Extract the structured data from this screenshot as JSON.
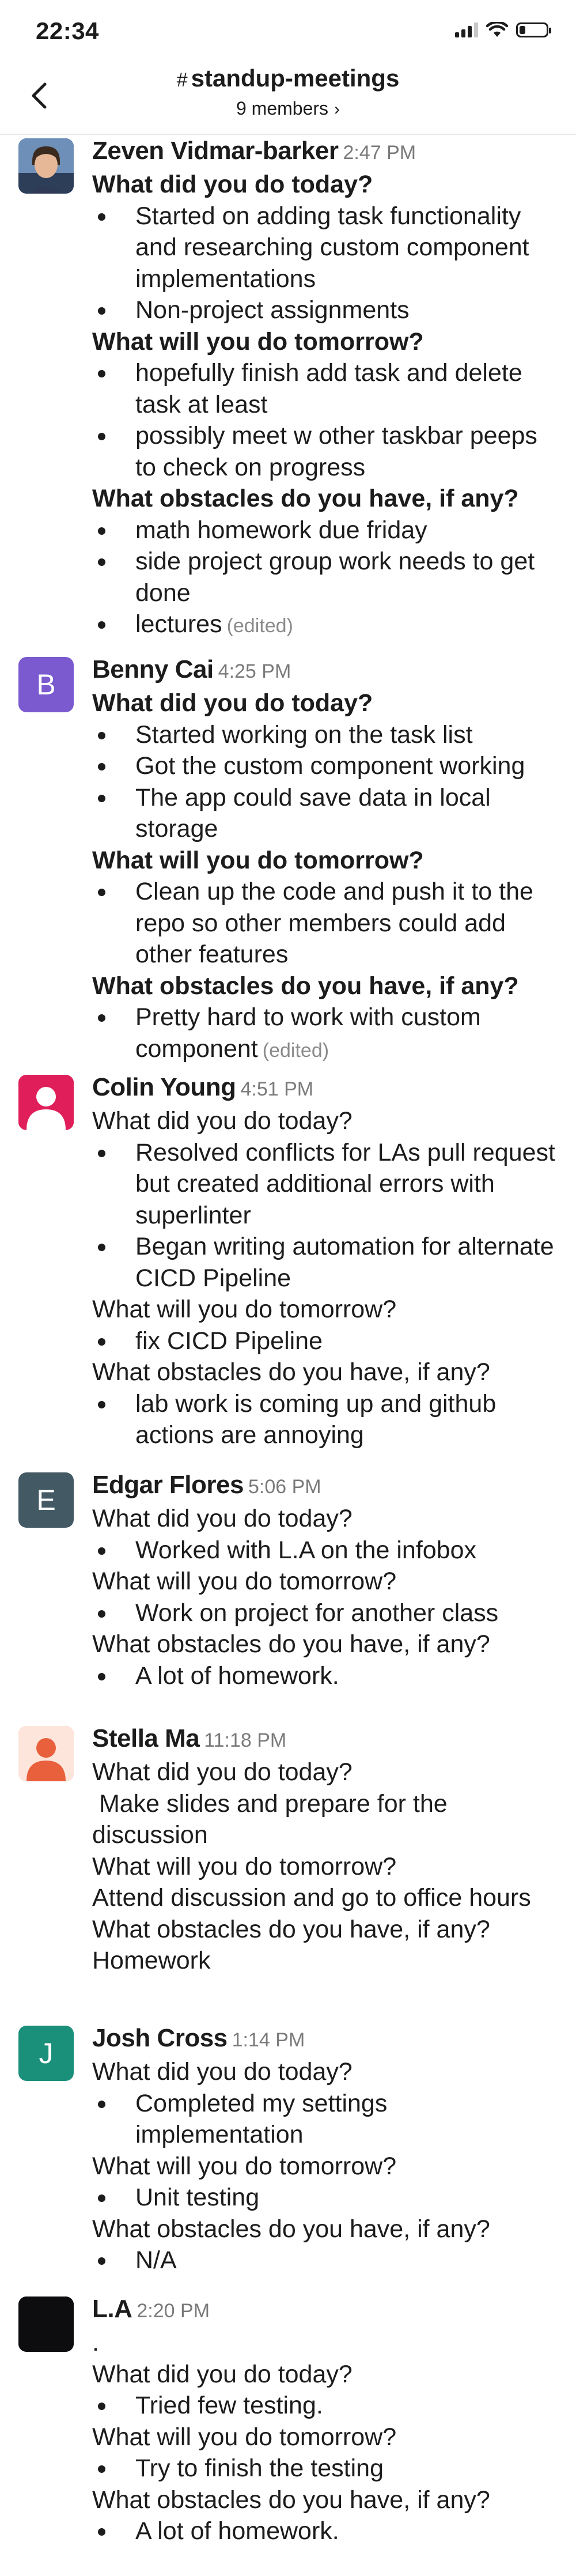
{
  "status_bar": {
    "time": "22:34"
  },
  "header": {
    "hash": "#",
    "channel_name": "standup-meetings",
    "member_count": "9 members",
    "member_chevron": "›",
    "back_icon": "chevron-left-icon"
  },
  "messages": [
    {
      "author": "Zeven Vidmar-barker",
      "time": "2:47 PM",
      "avatar": {
        "type": "photo",
        "color": "#3a5a8c"
      },
      "blocks": [
        {
          "kind": "heading",
          "text": "What did you do today?"
        },
        {
          "kind": "bullet",
          "text": "Started on adding task functionality and researching custom component implementations"
        },
        {
          "kind": "bullet",
          "text": "Non-project assignments"
        },
        {
          "kind": "heading",
          "text": "What will you do tomorrow?"
        },
        {
          "kind": "bullet",
          "text": "hopefully finish add task and delete task at least"
        },
        {
          "kind": "bullet",
          "text": "possibly meet w other taskbar peeps to check on progress"
        },
        {
          "kind": "heading",
          "text": "What obstacles do you have, if any?"
        },
        {
          "kind": "bullet",
          "text": "math homework due friday"
        },
        {
          "kind": "bullet",
          "text": "side project group work needs to get done"
        },
        {
          "kind": "bullet",
          "text": "lectures",
          "edited": "(edited)"
        }
      ]
    },
    {
      "author": "Benny Cai",
      "time": "4:25 PM",
      "avatar": {
        "type": "letter",
        "letter": "B",
        "color": "#7b5ad0"
      },
      "blocks": [
        {
          "kind": "heading",
          "text": "What did you do today?"
        },
        {
          "kind": "bullet",
          "text": "Started working on the task list"
        },
        {
          "kind": "bullet",
          "text": "Got the custom component working"
        },
        {
          "kind": "bullet",
          "text": "The app could save data in local storage"
        },
        {
          "kind": "heading",
          "text": "What will you do tomorrow?"
        },
        {
          "kind": "bullet",
          "text": "Clean up the code and push it to the repo so other members could add other features"
        },
        {
          "kind": "heading",
          "text": "What obstacles do you have, if any?"
        },
        {
          "kind": "bullet",
          "text": "Pretty hard to work with custom component",
          "edited": "(edited)"
        }
      ]
    },
    {
      "author": "Colin Young",
      "time": "4:51 PM",
      "avatar": {
        "type": "default",
        "color": "#e01e5a"
      },
      "blocks": [
        {
          "kind": "text",
          "text": "What did you do today?"
        },
        {
          "kind": "bullet",
          "text": "Resolved conflicts for LAs pull request but created additional errors with superlinter"
        },
        {
          "kind": "bullet",
          "text": "Began writing automation for alternate CICD Pipeline"
        },
        {
          "kind": "text",
          "text": "What will you do tomorrow?"
        },
        {
          "kind": "bullet",
          "text": "fix CICD Pipeline"
        },
        {
          "kind": "text",
          "text": "What obstacles do you have, if any?"
        },
        {
          "kind": "bullet",
          "text": "lab work is coming up and github actions are annoying"
        }
      ]
    },
    {
      "author": "Edgar Flores",
      "time": "5:06 PM",
      "avatar": {
        "type": "letter",
        "letter": "E",
        "color": "#435a64"
      },
      "blocks": [
        {
          "kind": "text",
          "text": "What did you do today?"
        },
        {
          "kind": "bullet",
          "text": "Worked with L.A on the infobox"
        },
        {
          "kind": "text",
          "text": "What will you do tomorrow?"
        },
        {
          "kind": "bullet",
          "text": "Work on project for another class"
        },
        {
          "kind": "text",
          "text": "What obstacles do you have, if any?"
        },
        {
          "kind": "bullet",
          "text": "A lot of homework."
        }
      ]
    },
    {
      "author": "Stella Ma",
      "time": "11:18 PM",
      "avatar": {
        "type": "default",
        "color": "#e8603c"
      },
      "blocks": [
        {
          "kind": "text",
          "text": "What did you do today?"
        },
        {
          "kind": "text",
          "text": " Make slides and prepare for the discussion"
        },
        {
          "kind": "text",
          "text": "What will you do tomorrow?"
        },
        {
          "kind": "text",
          "text": "Attend discussion and go to office hours"
        },
        {
          "kind": "text",
          "text": "What obstacles do you have, if any?"
        },
        {
          "kind": "text",
          "text": "Homework"
        }
      ]
    },
    {
      "author": "Josh Cross",
      "time": "1:14 PM",
      "avatar": {
        "type": "letter",
        "letter": "J",
        "color": "#1a8f7a"
      },
      "blocks": [
        {
          "kind": "text",
          "text": "What did you do today?"
        },
        {
          "kind": "bullet",
          "text": "Completed my settings implementation"
        },
        {
          "kind": "text",
          "text": "What will you do tomorrow?"
        },
        {
          "kind": "bullet",
          "text": "Unit testing"
        },
        {
          "kind": "text",
          "text": "What obstacles do you have, if any?"
        },
        {
          "kind": "bullet",
          "text": "N/A"
        }
      ]
    },
    {
      "author": "L.A",
      "time": "2:20 PM",
      "avatar": {
        "type": "dark",
        "color": "#0d0d10"
      },
      "blocks": [
        {
          "kind": "text",
          "text": "."
        },
        {
          "kind": "text",
          "text": "What did you do today?"
        },
        {
          "kind": "bullet",
          "text": "Tried few testing."
        },
        {
          "kind": "text",
          "text": "What will you do tomorrow?"
        },
        {
          "kind": "bullet",
          "text": "Try to finish the testing"
        },
        {
          "kind": "text",
          "text": "What obstacles do you have, if any?"
        },
        {
          "kind": "bullet",
          "text": "A lot of homework."
        }
      ]
    }
  ]
}
